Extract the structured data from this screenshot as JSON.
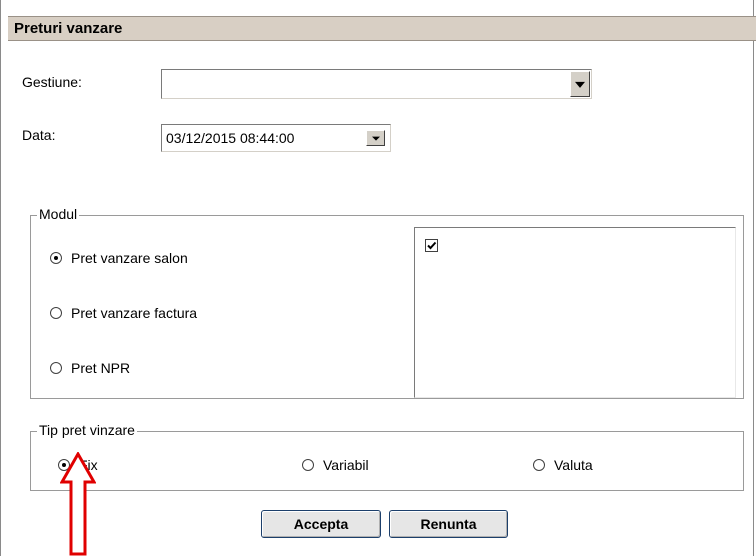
{
  "window": {
    "title": "Preturi vanzare"
  },
  "form": {
    "gestiune_label": "Gestiune:",
    "gestiune_value": "",
    "data_label": "Data:",
    "data_value": "03/12/2015 08:44:00"
  },
  "modul": {
    "legend": "Modul",
    "options": [
      {
        "label": "Pret vanzare salon",
        "selected": true
      },
      {
        "label": "Pret vanzare factura",
        "selected": false
      },
      {
        "label": "Pret NPR",
        "selected": false
      }
    ],
    "list_item_checked": true
  },
  "tip": {
    "legend": "Tip pret vinzare",
    "options": [
      {
        "label": "Fix",
        "selected": true
      },
      {
        "label": "Variabil",
        "selected": false
      },
      {
        "label": "Valuta",
        "selected": false
      }
    ]
  },
  "buttons": {
    "accept": "Accepta",
    "cancel": "Renunta"
  },
  "colors": {
    "title_bg": "#d8cfc4",
    "arrow": "#e00000",
    "button_border": "#1c3f6b"
  },
  "icons": {
    "annotation": "red-up-arrow"
  }
}
